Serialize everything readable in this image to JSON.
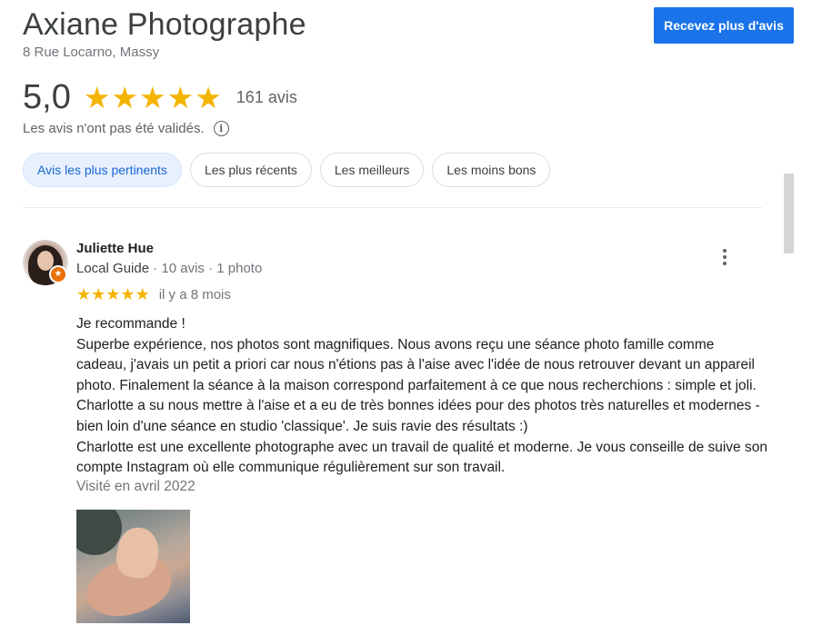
{
  "business": {
    "name": "Axiane Photographe",
    "address": "8 Rue Locarno, Massy",
    "rating": "5,0",
    "stars": 5,
    "review_count": "161 avis",
    "notice": "Les avis n'ont pas été validés."
  },
  "cta": {
    "label": "Recevez plus d'avis"
  },
  "sort_chips": [
    {
      "label": "Avis les plus pertinents",
      "active": true
    },
    {
      "label": "Les plus récents",
      "active": false
    },
    {
      "label": "Les meilleurs",
      "active": false
    },
    {
      "label": "Les moins bons",
      "active": false
    }
  ],
  "review": {
    "author": "Juliette Hue",
    "badge": "Local Guide",
    "stats": " · 10 avis · 1 photo",
    "stars": 5,
    "date": "il y a 8 mois",
    "text_lines": [
      "Je recommande !",
      "Superbe expérience, nos photos sont magnifiques. Nous avons reçu une séance photo famille comme cadeau, j'avais un petit a priori car nous n'étions pas à l'aise avec l'idée de nous retrouver devant un appareil photo. Finalement la séance à la maison correspond parfaitement à ce que nous recherchions : simple et joli. Charlotte a su nous mettre à l'aise et a eu de très bonnes idées pour des photos très naturelles et modernes - bien loin d'une séance en studio 'classique'. Je suis ravie des résultats :)",
      "Charlotte est une excellente photographe avec un travail de qualité et moderne. Je vous conseille de suive son compte Instagram où elle communique régulièrement sur son travail."
    ],
    "visited": "Visité en avril 2022"
  },
  "icons": {
    "star": "star-icon",
    "info": "info-icon",
    "more": "more-vert-icon",
    "local_guide": "local-guide-badge-icon"
  },
  "colors": {
    "accent": "#1a73e8",
    "star": "#f4b400",
    "chip_active_bg": "#e8f0fe",
    "chip_active_text": "#1967d2",
    "badge": "#e8710a"
  }
}
